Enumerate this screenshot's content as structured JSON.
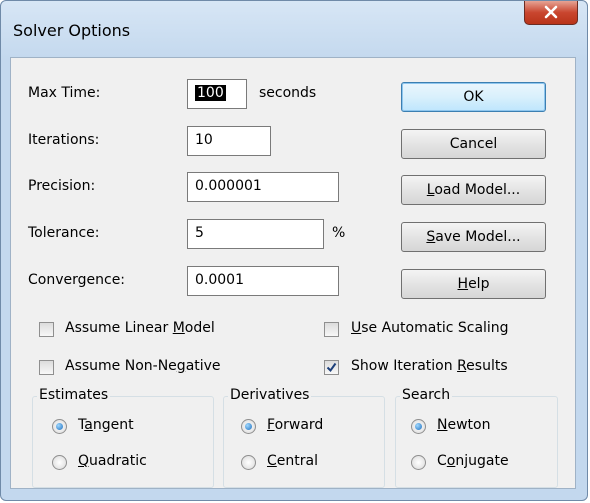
{
  "dialog": {
    "title": "Solver Options"
  },
  "fields": {
    "max_time": {
      "label": "Max Time:",
      "value": "100",
      "unit": "seconds"
    },
    "iterations": {
      "label": "Iterations:",
      "value": "10"
    },
    "precision": {
      "label": "Precision:",
      "value": "0.000001"
    },
    "tolerance": {
      "label": "Tolerance:",
      "value": "5",
      "unit": "%"
    },
    "convergence": {
      "label": "Convergence:",
      "value": "0.0001"
    }
  },
  "buttons": {
    "ok": "OK",
    "cancel": "Cancel",
    "load_model": {
      "pre": "",
      "key": "L",
      "post": "oad Model..."
    },
    "save_model": {
      "pre": "",
      "key": "S",
      "post": "ave Model..."
    },
    "help": {
      "pre": "",
      "key": "H",
      "post": "elp"
    }
  },
  "checkboxes": {
    "assume_linear": {
      "pre": "Assume Linear ",
      "key": "M",
      "post": "odel",
      "checked": false
    },
    "use_auto_scaling": {
      "pre": "",
      "key": "U",
      "post": "se Automatic Scaling",
      "checked": false
    },
    "assume_non_negative": {
      "pre": "Assume Non-Ne",
      "key": "g",
      "post": "ative",
      "checked": false
    },
    "show_iteration": {
      "pre": "Show Iteration ",
      "key": "R",
      "post": "esults",
      "checked": true
    }
  },
  "groups": {
    "estimates": {
      "label": "Estimates",
      "tangent": {
        "pre": "T",
        "key": "a",
        "post": "ngent",
        "selected": true
      },
      "quadratic": {
        "pre": "",
        "key": "Q",
        "post": "uadratic",
        "selected": false
      }
    },
    "derivatives": {
      "label": "Derivatives",
      "forward": {
        "pre": "",
        "key": "F",
        "post": "orward",
        "selected": true
      },
      "central": {
        "pre": "",
        "key": "C",
        "post": "entral",
        "selected": false
      }
    },
    "search": {
      "label": "Search",
      "newton": {
        "pre": "",
        "key": "N",
        "post": "ewton",
        "selected": true
      },
      "conjugate": {
        "pre": "C",
        "key": "o",
        "post": "njugate",
        "selected": false
      }
    }
  },
  "icons": {
    "close": "close-icon",
    "check": "checkmark-icon"
  }
}
